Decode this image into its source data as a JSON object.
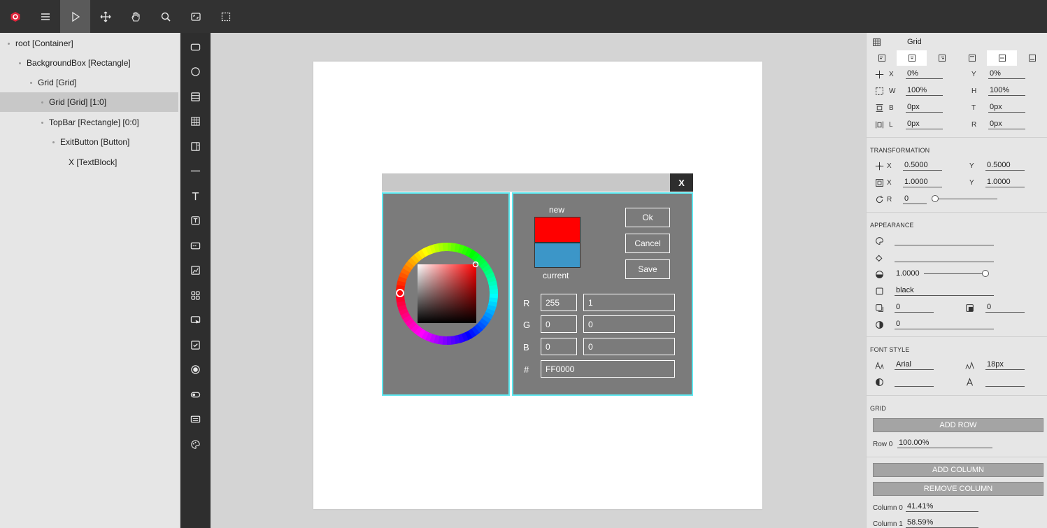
{
  "toolbar": {
    "logo_icon": "logo-icon",
    "items": [
      "menu-icon",
      "select-arrow-icon",
      "move-icon",
      "hand-icon",
      "search-icon",
      "frame-icon",
      "selection-marquee-icon"
    ]
  },
  "tree": {
    "items": [
      {
        "label": "root [Container]"
      },
      {
        "label": "BackgroundBox [Rectangle]"
      },
      {
        "label": "Grid [Grid]"
      },
      {
        "label": "Grid [Grid] [1:0]"
      },
      {
        "label": "TopBar [Rectangle] [0:0]"
      },
      {
        "label": "ExitButton [Button]"
      },
      {
        "label": "X [TextBlock]"
      }
    ]
  },
  "tools": [
    "rectangle-tool-icon",
    "ellipse-tool-icon",
    "stack-tool-icon",
    "grid-tool-icon",
    "panel-tool-icon",
    "line-tool-icon",
    "text-tool-icon",
    "textbox-tool-icon",
    "input-tool-icon",
    "image-tool-icon",
    "grid-container-tool-icon",
    "button-tool-icon",
    "checkbox-tool-icon",
    "radio-tool-icon",
    "toggle-tool-icon",
    "keyboard-tool-icon",
    "color-picker-tool-icon"
  ],
  "dialog": {
    "close_label": "X",
    "new_label": "new",
    "current_label": "current",
    "new_color": "#ff0000",
    "current_color": "#3c96c8",
    "ok_label": "Ok",
    "cancel_label": "Cancel",
    "save_label": "Save",
    "r_label": "R",
    "r_value": "255",
    "r_float": "1",
    "g_label": "G",
    "g_value": "0",
    "g_float": "0",
    "b_label": "B",
    "b_value": "0",
    "b_float": "0",
    "hex_label": "#",
    "hex_value": "FF0000",
    "accent_color": "#5ee8f0"
  },
  "props": {
    "title": "Grid",
    "position": {
      "x_label": "X",
      "x_value": "0%",
      "y_label": "Y",
      "y_value": "0%",
      "w_label": "W",
      "w_value": "100%",
      "h_label": "H",
      "h_value": "100%",
      "b_label": "B",
      "b_value": "0px",
      "t_label": "T",
      "t_value": "0px",
      "l_label": "L",
      "l_value": "0px",
      "r_label": "R",
      "r_value": "0px"
    },
    "transformation": {
      "heading": "TRANSFORMATION",
      "origin_x_label": "X",
      "origin_x": "0.5000",
      "origin_y_label": "Y",
      "origin_y": "0.5000",
      "scale_x_label": "X",
      "scale_x": "1.0000",
      "scale_y_label": "Y",
      "scale_y": "1.0000",
      "rotation_label": "R",
      "rotation": "0"
    },
    "appearance": {
      "heading": "APPEARANCE",
      "alpha": "1.0000",
      "color": "black",
      "shadow_a": "0",
      "shadow_b": "0",
      "outline": "0"
    },
    "font": {
      "heading": "FONT STYLE",
      "family": "Arial",
      "size": "18px"
    },
    "grid": {
      "heading": "GRID",
      "add_row": "ADD ROW",
      "row0_label": "Row 0",
      "row0_value": "100.00%",
      "add_column": "ADD COLUMN",
      "remove_column": "REMOVE COLUMN",
      "col0_label": "Column 0",
      "col0_value": "41.41%",
      "col1_label": "Column 1",
      "col1_value": "58.59%"
    }
  }
}
